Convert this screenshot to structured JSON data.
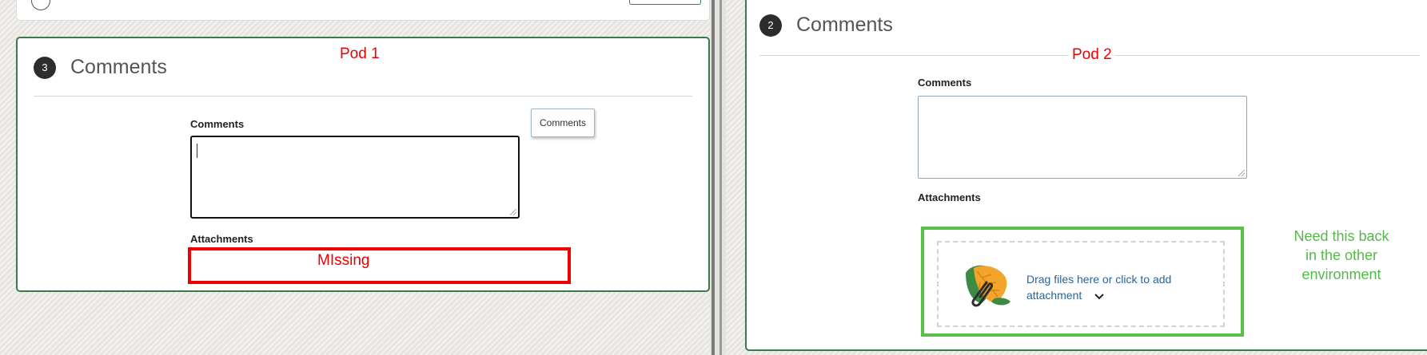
{
  "left": {
    "section": {
      "number": "3",
      "title": "Comments"
    },
    "annotation_pod": "Pod 1",
    "comments_label": "Comments",
    "tooltip": "Comments",
    "attachments_label": "Attachments",
    "annotation_missing": "MIssing"
  },
  "right": {
    "section": {
      "number": "2",
      "title": "Comments"
    },
    "annotation_pod": "Pod 2",
    "comments_label": "Comments",
    "attachments_label": "Attachments",
    "dropzone": {
      "line1": "Drag files here or click to add",
      "line2": "attachment"
    },
    "annotation_need": [
      "Need this back",
      "in the other",
      "environment"
    ]
  },
  "colors": {
    "annotation_red": "#e00000",
    "annotation_green": "#5cbf4a",
    "accent_green": "#3c7a4a"
  }
}
